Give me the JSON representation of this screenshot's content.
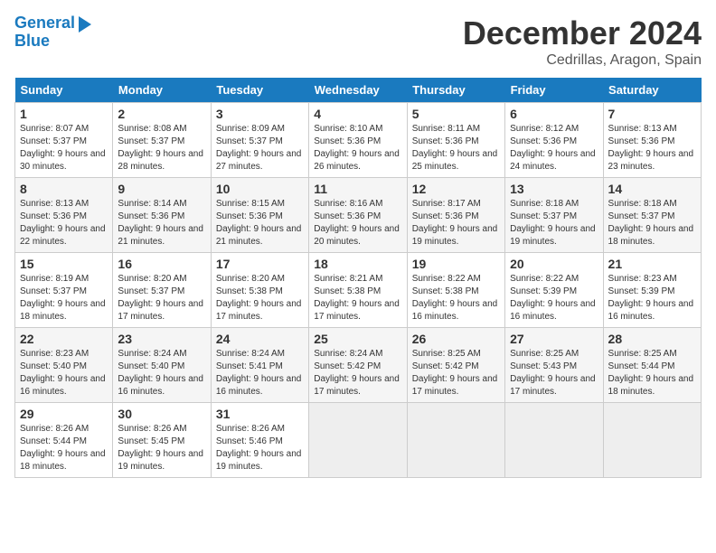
{
  "logo": {
    "line1": "General",
    "line2": "Blue"
  },
  "title": "December 2024",
  "location": "Cedrillas, Aragon, Spain",
  "days_of_week": [
    "Sunday",
    "Monday",
    "Tuesday",
    "Wednesday",
    "Thursday",
    "Friday",
    "Saturday"
  ],
  "weeks": [
    [
      {
        "day": "1",
        "sunrise": "8:07 AM",
        "sunset": "5:37 PM",
        "daylight": "9 hours and 30 minutes."
      },
      {
        "day": "2",
        "sunrise": "8:08 AM",
        "sunset": "5:37 PM",
        "daylight": "9 hours and 28 minutes."
      },
      {
        "day": "3",
        "sunrise": "8:09 AM",
        "sunset": "5:37 PM",
        "daylight": "9 hours and 27 minutes."
      },
      {
        "day": "4",
        "sunrise": "8:10 AM",
        "sunset": "5:36 PM",
        "daylight": "9 hours and 26 minutes."
      },
      {
        "day": "5",
        "sunrise": "8:11 AM",
        "sunset": "5:36 PM",
        "daylight": "9 hours and 25 minutes."
      },
      {
        "day": "6",
        "sunrise": "8:12 AM",
        "sunset": "5:36 PM",
        "daylight": "9 hours and 24 minutes."
      },
      {
        "day": "7",
        "sunrise": "8:13 AM",
        "sunset": "5:36 PM",
        "daylight": "9 hours and 23 minutes."
      }
    ],
    [
      {
        "day": "8",
        "sunrise": "8:13 AM",
        "sunset": "5:36 PM",
        "daylight": "9 hours and 22 minutes."
      },
      {
        "day": "9",
        "sunrise": "8:14 AM",
        "sunset": "5:36 PM",
        "daylight": "9 hours and 21 minutes."
      },
      {
        "day": "10",
        "sunrise": "8:15 AM",
        "sunset": "5:36 PM",
        "daylight": "9 hours and 21 minutes."
      },
      {
        "day": "11",
        "sunrise": "8:16 AM",
        "sunset": "5:36 PM",
        "daylight": "9 hours and 20 minutes."
      },
      {
        "day": "12",
        "sunrise": "8:17 AM",
        "sunset": "5:36 PM",
        "daylight": "9 hours and 19 minutes."
      },
      {
        "day": "13",
        "sunrise": "8:18 AM",
        "sunset": "5:37 PM",
        "daylight": "9 hours and 19 minutes."
      },
      {
        "day": "14",
        "sunrise": "8:18 AM",
        "sunset": "5:37 PM",
        "daylight": "9 hours and 18 minutes."
      }
    ],
    [
      {
        "day": "15",
        "sunrise": "8:19 AM",
        "sunset": "5:37 PM",
        "daylight": "9 hours and 18 minutes."
      },
      {
        "day": "16",
        "sunrise": "8:20 AM",
        "sunset": "5:37 PM",
        "daylight": "9 hours and 17 minutes."
      },
      {
        "day": "17",
        "sunrise": "8:20 AM",
        "sunset": "5:38 PM",
        "daylight": "9 hours and 17 minutes."
      },
      {
        "day": "18",
        "sunrise": "8:21 AM",
        "sunset": "5:38 PM",
        "daylight": "9 hours and 17 minutes."
      },
      {
        "day": "19",
        "sunrise": "8:22 AM",
        "sunset": "5:38 PM",
        "daylight": "9 hours and 16 minutes."
      },
      {
        "day": "20",
        "sunrise": "8:22 AM",
        "sunset": "5:39 PM",
        "daylight": "9 hours and 16 minutes."
      },
      {
        "day": "21",
        "sunrise": "8:23 AM",
        "sunset": "5:39 PM",
        "daylight": "9 hours and 16 minutes."
      }
    ],
    [
      {
        "day": "22",
        "sunrise": "8:23 AM",
        "sunset": "5:40 PM",
        "daylight": "9 hours and 16 minutes."
      },
      {
        "day": "23",
        "sunrise": "8:24 AM",
        "sunset": "5:40 PM",
        "daylight": "9 hours and 16 minutes."
      },
      {
        "day": "24",
        "sunrise": "8:24 AM",
        "sunset": "5:41 PM",
        "daylight": "9 hours and 16 minutes."
      },
      {
        "day": "25",
        "sunrise": "8:24 AM",
        "sunset": "5:42 PM",
        "daylight": "9 hours and 17 minutes."
      },
      {
        "day": "26",
        "sunrise": "8:25 AM",
        "sunset": "5:42 PM",
        "daylight": "9 hours and 17 minutes."
      },
      {
        "day": "27",
        "sunrise": "8:25 AM",
        "sunset": "5:43 PM",
        "daylight": "9 hours and 17 minutes."
      },
      {
        "day": "28",
        "sunrise": "8:25 AM",
        "sunset": "5:44 PM",
        "daylight": "9 hours and 18 minutes."
      }
    ],
    [
      {
        "day": "29",
        "sunrise": "8:26 AM",
        "sunset": "5:44 PM",
        "daylight": "9 hours and 18 minutes."
      },
      {
        "day": "30",
        "sunrise": "8:26 AM",
        "sunset": "5:45 PM",
        "daylight": "9 hours and 19 minutes."
      },
      {
        "day": "31",
        "sunrise": "8:26 AM",
        "sunset": "5:46 PM",
        "daylight": "9 hours and 19 minutes."
      },
      null,
      null,
      null,
      null
    ]
  ]
}
